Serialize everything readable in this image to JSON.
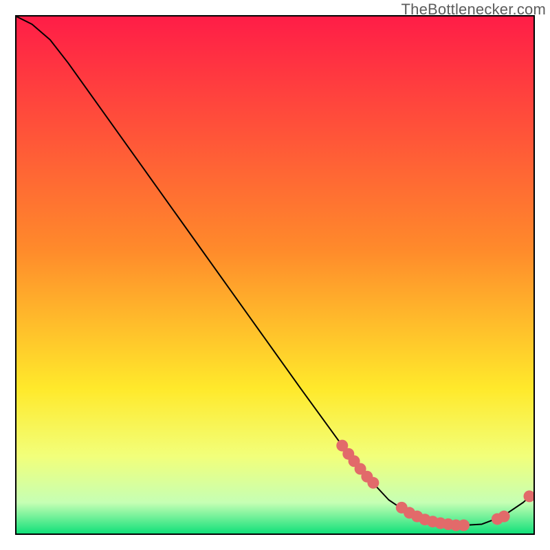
{
  "watermark": "TheBottlenecker.com",
  "chart_data": {
    "type": "line",
    "title": "",
    "xlabel": "",
    "ylabel": "",
    "xlim": [
      0,
      100
    ],
    "ylim": [
      0,
      100
    ],
    "background_gradient": {
      "top": "#ff1d47",
      "mid_top": "#ff8a2b",
      "mid": "#ffe92b",
      "mid_bottom": "#f2ff7a",
      "bottom_pale": "#c6ffb4",
      "bottom": "#12e07a"
    },
    "curve": [
      {
        "x": 0.0,
        "y": 100.0
      },
      {
        "x": 3.0,
        "y": 98.5
      },
      {
        "x": 6.5,
        "y": 95.5
      },
      {
        "x": 10.0,
        "y": 91.0
      },
      {
        "x": 15.0,
        "y": 84.0
      },
      {
        "x": 25.0,
        "y": 70.0
      },
      {
        "x": 35.0,
        "y": 56.0
      },
      {
        "x": 45.0,
        "y": 42.0
      },
      {
        "x": 55.0,
        "y": 28.0
      },
      {
        "x": 63.0,
        "y": 17.0
      },
      {
        "x": 68.0,
        "y": 10.8
      },
      {
        "x": 72.0,
        "y": 6.5
      },
      {
        "x": 76.0,
        "y": 3.8
      },
      {
        "x": 80.0,
        "y": 2.2
      },
      {
        "x": 85.0,
        "y": 1.5
      },
      {
        "x": 90.0,
        "y": 1.8
      },
      {
        "x": 94.0,
        "y": 3.3
      },
      {
        "x": 98.0,
        "y": 6.0
      },
      {
        "x": 100.0,
        "y": 7.8
      }
    ],
    "cluster1": [
      {
        "x": 63.0,
        "y": 17.0
      },
      {
        "x": 64.2,
        "y": 15.4
      },
      {
        "x": 65.3,
        "y": 14.0
      },
      {
        "x": 66.5,
        "y": 12.5
      },
      {
        "x": 67.8,
        "y": 11.0
      },
      {
        "x": 69.0,
        "y": 9.8
      }
    ],
    "cluster2": [
      {
        "x": 74.5,
        "y": 5.0
      },
      {
        "x": 76.0,
        "y": 4.0
      },
      {
        "x": 77.5,
        "y": 3.3
      },
      {
        "x": 79.0,
        "y": 2.7
      },
      {
        "x": 80.5,
        "y": 2.3
      },
      {
        "x": 82.0,
        "y": 2.0
      },
      {
        "x": 83.5,
        "y": 1.8
      },
      {
        "x": 85.0,
        "y": 1.6
      },
      {
        "x": 86.5,
        "y": 1.6
      }
    ],
    "cluster3": [
      {
        "x": 93.0,
        "y": 2.8
      },
      {
        "x": 94.3,
        "y": 3.3
      }
    ],
    "cluster4": [
      {
        "x": 99.2,
        "y": 7.2
      }
    ],
    "marker_color": "#e26a6a",
    "marker_radius": 8.5
  }
}
